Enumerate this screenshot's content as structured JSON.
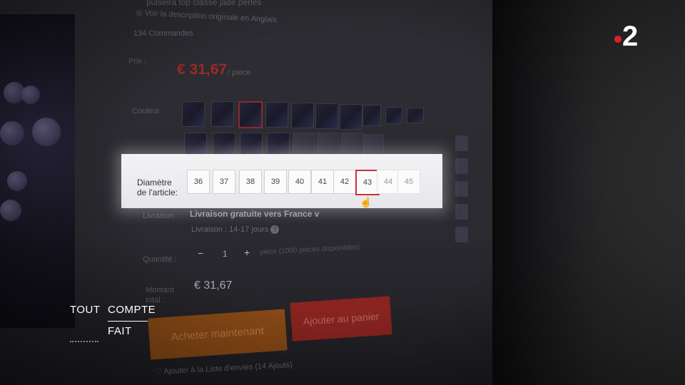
{
  "listing": {
    "title_fragment": "pulseira top classe jade perles",
    "original_description_link": "Voir la description originale en Anglais",
    "orders": "134 Commandes"
  },
  "price": {
    "label": "Prix :",
    "value": "€ 31,67",
    "unit": "/ pièce"
  },
  "color": {
    "label": "Couleur :"
  },
  "size": {
    "label_line1": "Diamètre",
    "label_line2": "de l'article:",
    "options": [
      "36",
      "37",
      "38",
      "39",
      "40",
      "41",
      "42",
      "43",
      "44",
      "45"
    ],
    "selected": "43"
  },
  "delivery": {
    "label": "Livraison :",
    "value": "Livraison gratuite vers France v",
    "time": "Livraison : 14-17 jours"
  },
  "quantity": {
    "label": "Quantité :",
    "minus": "−",
    "value": "1",
    "plus": "+",
    "available": "pièce (1000 pièces disponibles)"
  },
  "total": {
    "label_line1": "Montant",
    "label_line2": "total :",
    "value": "€ 31,67"
  },
  "buttons": {
    "buy_now": "Acheter maintenant",
    "add_to_cart": "Ajouter au panier"
  },
  "wishlist": {
    "label": "Ajouter à la Liste d'envies",
    "count": "(14 Ajouts)"
  },
  "overlay": {
    "channel_logo": "2",
    "show_title_word1": "TOUT",
    "show_title_word2": "COMPTE",
    "show_title_word3": "FAIT"
  },
  "colors": {
    "price_red": "#9a2a2a",
    "selected_border": "#c8333a",
    "buy_button": "#8a4a16",
    "cart_button": "#8a2420",
    "logo_red": "#d8232a"
  }
}
